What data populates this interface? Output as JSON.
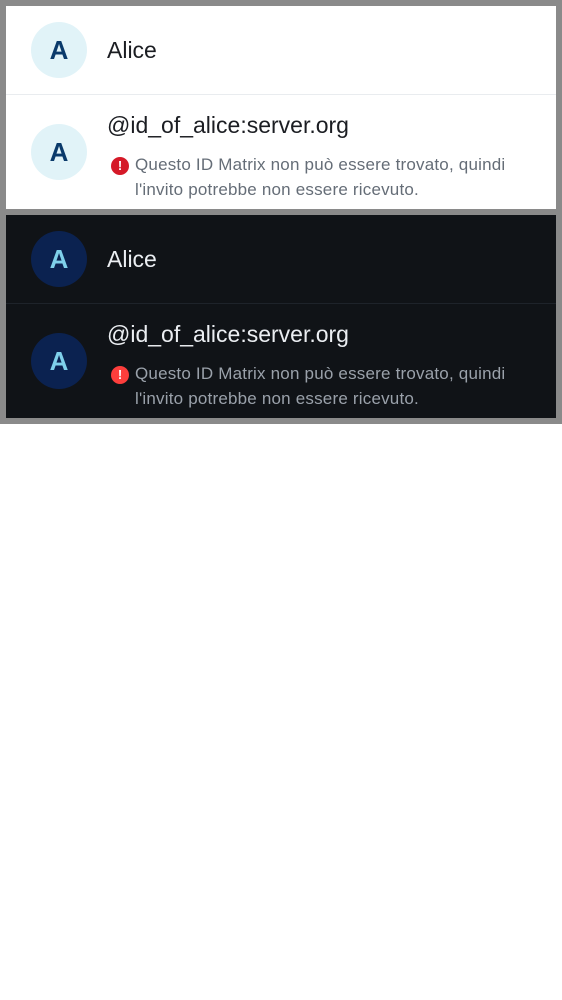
{
  "panels": [
    {
      "theme": "light",
      "user": {
        "avatar_letter": "A",
        "display_name": "Alice"
      },
      "invite": {
        "avatar_letter": "A",
        "matrix_id": "@id_of_alice:server.org",
        "warning_icon": "error-icon",
        "warning_text": "Questo ID Matrix non può essere trovato, quindi l'invito potrebbe non essere ricevuto."
      }
    },
    {
      "theme": "dark",
      "user": {
        "avatar_letter": "A",
        "display_name": "Alice"
      },
      "invite": {
        "avatar_letter": "A",
        "matrix_id": "@id_of_alice:server.org",
        "warning_icon": "error-icon",
        "warning_text": "Questo ID Matrix non può essere trovato, quindi l'invito potrebbe non essere ricevuto."
      }
    }
  ],
  "colors": {
    "light_background": "#ffffff",
    "dark_background": "#101317",
    "light_avatar_bg": "#e1f3f8",
    "light_avatar_fg": "#0a3a6b",
    "dark_avatar_bg": "#0b2250",
    "dark_avatar_fg": "#7fd0ea",
    "light_error": "#d51928",
    "dark_error": "#fd3e3c"
  }
}
